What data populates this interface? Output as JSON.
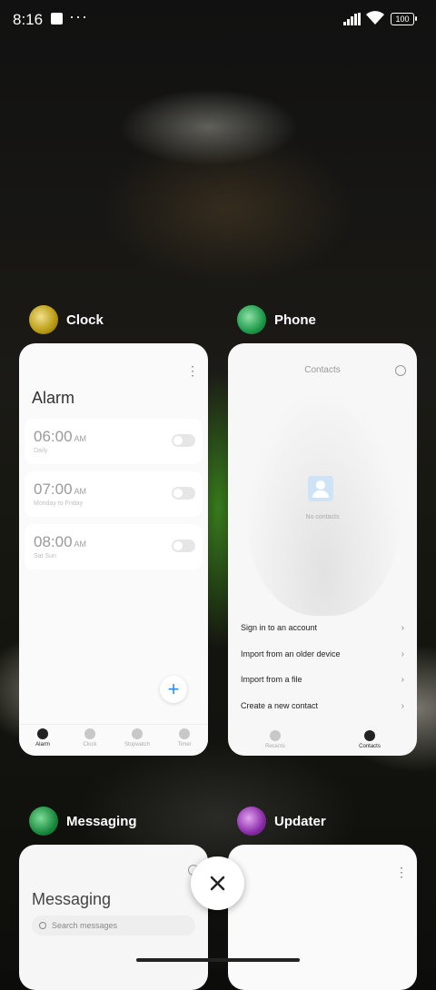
{
  "status_bar": {
    "time": "8:16",
    "dots": "···",
    "battery": "100"
  },
  "cards": {
    "clock": {
      "app_name": "Clock",
      "title": "Alarm",
      "alarms": [
        {
          "time": "06:00",
          "ampm": "AM",
          "sub": "Daily"
        },
        {
          "time": "07:00",
          "ampm": "AM",
          "sub": "Monday to Friday"
        },
        {
          "time": "08:00",
          "ampm": "AM",
          "sub": "Sat Sun"
        }
      ],
      "fab": "+",
      "nav": [
        "Alarm",
        "Clock",
        "Stopwatch",
        "Timer"
      ]
    },
    "phone": {
      "app_name": "Phone",
      "title": "Contacts",
      "empty": "No contacts",
      "options": [
        "Sign in to an account",
        "Import from an older device",
        "Import from a file",
        "Create a new contact"
      ],
      "nav": [
        "Recents",
        "Contacts"
      ]
    },
    "messaging": {
      "app_name": "Messaging",
      "title": "Messaging",
      "search_placeholder": "Search messages"
    },
    "updater": {
      "app_name": "Updater"
    }
  },
  "icons": {
    "close": "close-icon",
    "chevron": "chevron-right-icon"
  }
}
